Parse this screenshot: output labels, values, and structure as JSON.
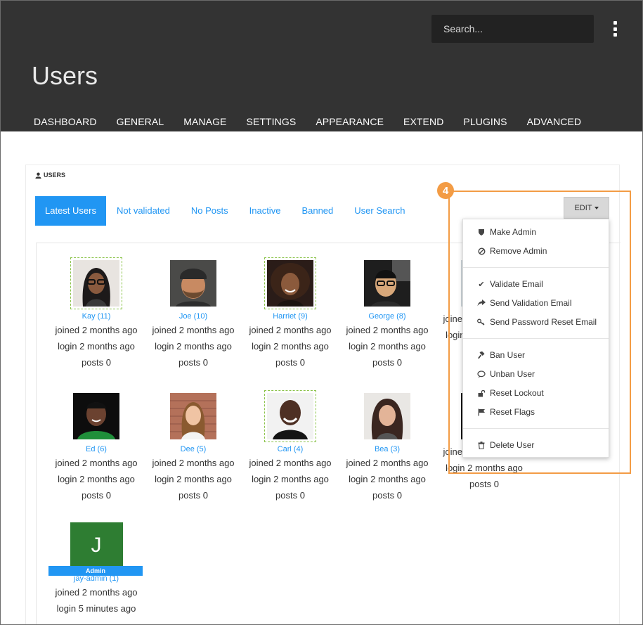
{
  "header": {
    "search_placeholder": "Search...",
    "title": "Users",
    "nav": [
      "DASHBOARD",
      "GENERAL",
      "MANAGE",
      "SETTINGS",
      "APPEARANCE",
      "EXTEND",
      "PLUGINS",
      "ADVANCED"
    ]
  },
  "panel": {
    "heading": "USERS",
    "tabs": [
      "Latest Users",
      "Not validated",
      "No Posts",
      "Inactive",
      "Banned",
      "User Search"
    ],
    "active_tab": "Latest Users",
    "edit_label": "EDIT"
  },
  "users": [
    {
      "name": "Kay (11)",
      "joined": "joined 2 months ago",
      "login": "login 2 months ago",
      "posts": "posts 0",
      "avatar": "photo-woman-glasses",
      "selected": true
    },
    {
      "name": "Joe (10)",
      "joined": "joined 2 months ago",
      "login": "login 2 months ago",
      "posts": "posts 0",
      "avatar": "photo-man-beard-cap",
      "selected": false
    },
    {
      "name": "Harriet (9)",
      "joined": "joined 2 months ago",
      "login": "login 2 months ago",
      "posts": "posts 0",
      "avatar": "photo-woman-curly-hair",
      "selected": true
    },
    {
      "name": "George (8)",
      "joined": "joined 2 months ago",
      "login": "login 2 months ago",
      "posts": "posts 0",
      "avatar": "photo-man-glasses",
      "selected": false
    },
    {
      "name": "",
      "joined": "joined 2 months ago",
      "login": "login 2 months ago",
      "posts": "",
      "avatar": "hidden",
      "selected": false
    },
    {
      "name": "Ed (6)",
      "joined": "joined 2 months ago",
      "login": "login 2 months ago",
      "posts": "posts 0",
      "avatar": "photo-man-green-shirt",
      "selected": false
    },
    {
      "name": "Dee (5)",
      "joined": "joined 2 months ago",
      "login": "login 2 months ago",
      "posts": "posts 0",
      "avatar": "photo-woman-brick-wall",
      "selected": false
    },
    {
      "name": "Carl (4)",
      "joined": "joined 2 months ago",
      "login": "login 2 months ago",
      "posts": "posts 0",
      "avatar": "photo-man-smiling",
      "selected": true
    },
    {
      "name": "Bea (3)",
      "joined": "joined 2 months ago",
      "login": "login 2 months ago",
      "posts": "posts 0",
      "avatar": "photo-woman-dark-hair",
      "selected": false
    },
    {
      "name": "",
      "joined": "joined 2 months ago",
      "login": "login 2 months ago",
      "posts": "posts 0",
      "avatar": "hidden",
      "selected": false
    },
    {
      "name": "jay-admin (1)",
      "joined": "joined 2 months ago",
      "login": "login 5 minutes ago",
      "posts": "",
      "avatar_letter": "J",
      "badge": "Admin",
      "selected": false
    }
  ],
  "menu": {
    "items": [
      {
        "label": "Make Admin",
        "icon": "shield-icon"
      },
      {
        "label": "Remove Admin",
        "icon": "ban-icon"
      },
      {
        "label": "Validate Email",
        "icon": "check-icon"
      },
      {
        "label": "Send Validation Email",
        "icon": "share-icon"
      },
      {
        "label": "Send Password Reset Email",
        "icon": "key-icon"
      },
      {
        "label": "Ban User",
        "icon": "gavel-icon"
      },
      {
        "label": "Unban User",
        "icon": "comment-icon"
      },
      {
        "label": "Reset Lockout",
        "icon": "unlock-icon"
      },
      {
        "label": "Reset Flags",
        "icon": "flag-icon"
      },
      {
        "label": "Delete User",
        "icon": "trash-icon"
      }
    ]
  },
  "callout": {
    "number": "4"
  },
  "colors": {
    "header_bg": "#333333",
    "accent": "#2196f3",
    "callout": "#f39c45",
    "admin_avatar": "#2e7d32"
  }
}
